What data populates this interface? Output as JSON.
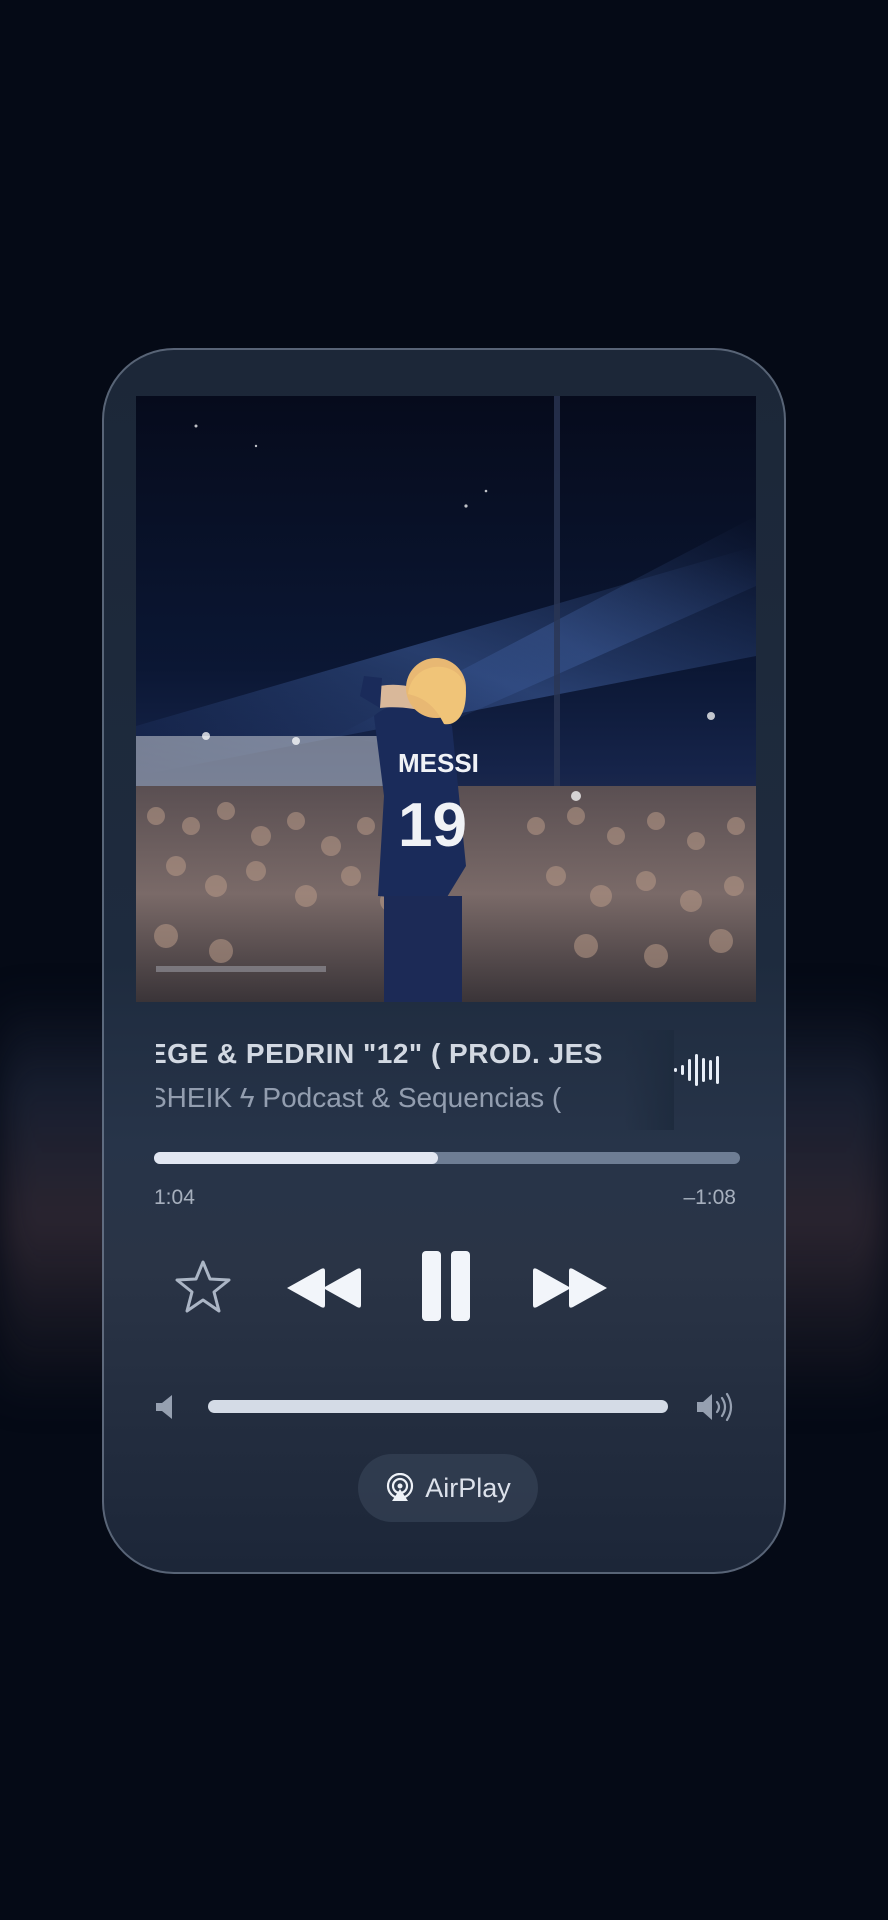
{
  "now_playing": {
    "title": "EGE & PEDRIN \"12\" ( PROD. JES",
    "artist": "SHEIK ϟ Podcast & Sequencias ("
  },
  "progress": {
    "elapsed": "1:04",
    "remaining": "–1:08",
    "fraction": 0.485
  },
  "artwork": {
    "jersey_name": "MESSI",
    "jersey_number": "19"
  },
  "controls": {
    "favorite_icon": "star-outline-icon",
    "rewind_icon": "rewind-icon",
    "pause_icon": "pause-icon",
    "forward_icon": "fast-forward-icon"
  },
  "volume": {
    "level": 1.0,
    "min_icon": "speaker-low-icon",
    "max_icon": "speaker-high-icon"
  },
  "airplay": {
    "label": "AirPlay",
    "icon": "airplay-icon"
  },
  "colors": {
    "background": "#050a16",
    "card": "#1e2b3e",
    "accent": "#e8eef8"
  }
}
